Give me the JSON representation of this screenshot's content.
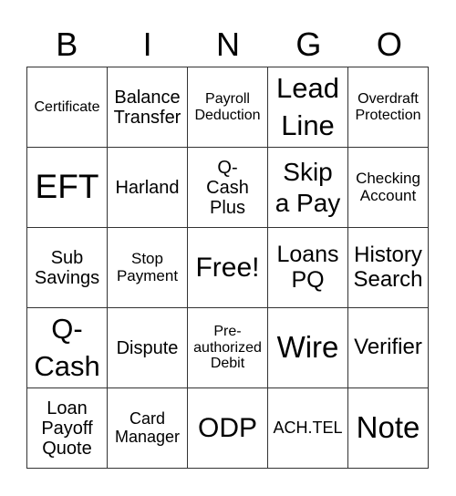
{
  "header": [
    "B",
    "I",
    "N",
    "G",
    "O"
  ],
  "rows": [
    [
      "Certificate",
      "Balance\nTransfer",
      "Payroll\nDeduction",
      "Lead\nLine",
      "Overdraft\nProtection"
    ],
    [
      "EFT",
      "Harland",
      "Q-\nCash\nPlus",
      "Skip\na Pay",
      "Checking\nAccount"
    ],
    [
      "Sub\nSavings",
      "Stop\nPayment",
      "Free!",
      "Loans\nPQ",
      "History\nSearch"
    ],
    [
      "Q-\nCash",
      "Dispute",
      "Pre-\nauthorized\nDebit",
      "Wire",
      "Verifier"
    ],
    [
      "Loan\nPayoff\nQuote",
      "Card\nManager",
      "ODP",
      "ACH.TEL",
      "Note"
    ]
  ]
}
